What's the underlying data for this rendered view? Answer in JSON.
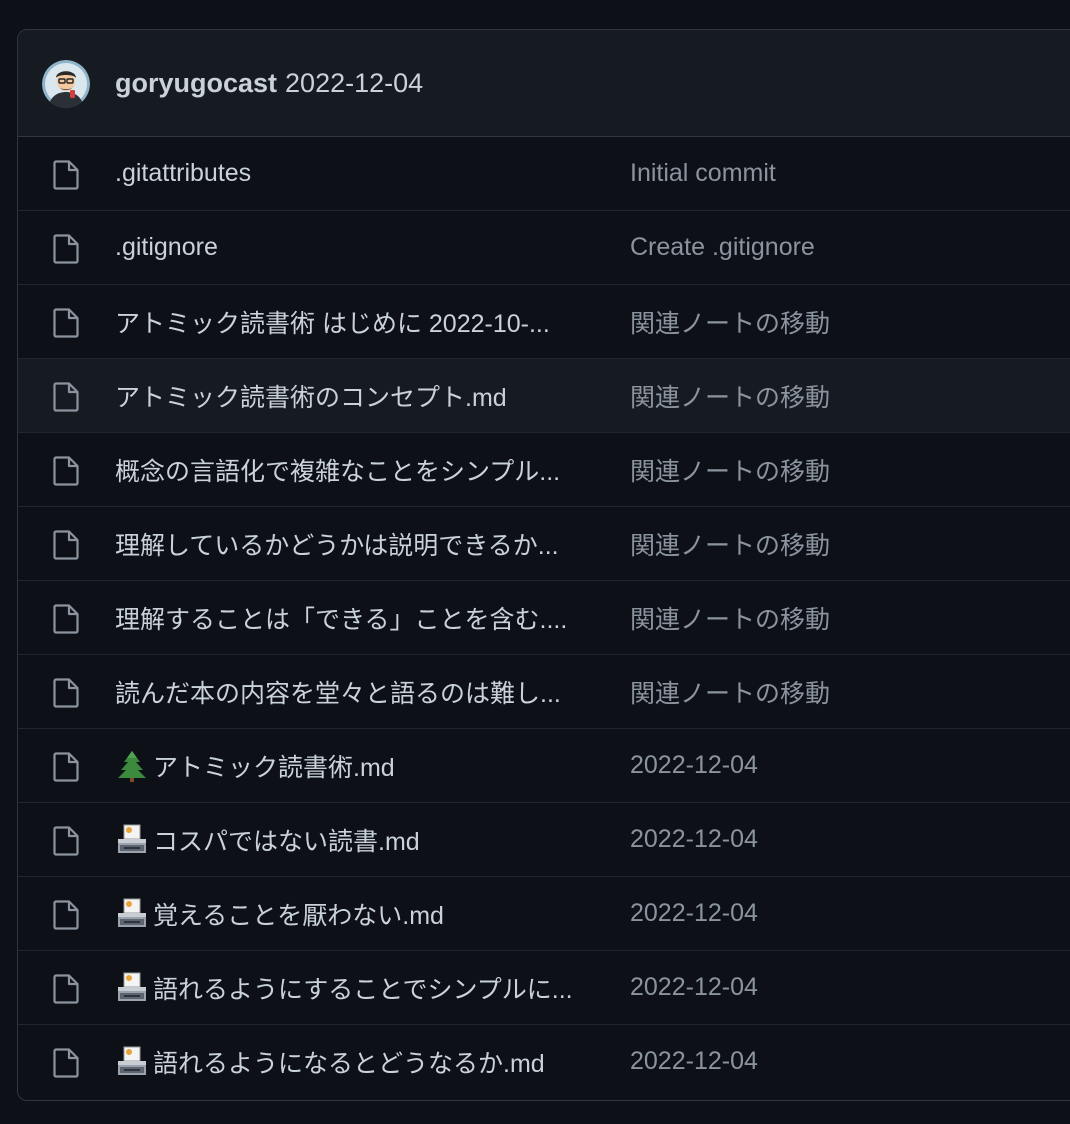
{
  "commit": {
    "author": "goryugocast",
    "message": "2022-12-04",
    "avatar_icon": "avatar-icon"
  },
  "colors": {
    "background": "#0d1117",
    "header_background": "#161b22",
    "border": "#30363d",
    "text": "#c9d1d9",
    "muted": "#8b949e"
  },
  "files": [
    {
      "name": ".gitattributes",
      "commit": "Initial commit",
      "icon": "file-icon",
      "emoji": ""
    },
    {
      "name": ".gitignore",
      "commit": "Create .gitignore",
      "icon": "file-icon",
      "emoji": ""
    },
    {
      "name": "アトミック読書術 はじめに 2022-10-...",
      "commit": "関連ノートの移動",
      "icon": "file-icon",
      "emoji": ""
    },
    {
      "name": "アトミック読書術のコンセプト.md",
      "commit": "関連ノートの移動",
      "icon": "file-icon",
      "emoji": ""
    },
    {
      "name": "概念の言語化で複雑なことをシンプル...",
      "commit": "関連ノートの移動",
      "icon": "file-icon",
      "emoji": ""
    },
    {
      "name": "理解しているかどうかは説明できるか...",
      "commit": "関連ノートの移動",
      "icon": "file-icon",
      "emoji": ""
    },
    {
      "name": "理解することは「できる」ことを含む....",
      "commit": "関連ノートの移動",
      "icon": "file-icon",
      "emoji": ""
    },
    {
      "name": "読んだ本の内容を堂々と語るのは難し...",
      "commit": "関連ノートの移動",
      "icon": "file-icon",
      "emoji": ""
    },
    {
      "name": "アトミック読書術.md",
      "commit": "2022-12-04",
      "icon": "file-icon",
      "emoji": "evergreen-tree-icon"
    },
    {
      "name": "コスパではない読書.md",
      "commit": "2022-12-04",
      "icon": "file-icon",
      "emoji": "inbox-tray-icon"
    },
    {
      "name": "覚えることを厭わない.md",
      "commit": "2022-12-04",
      "icon": "file-icon",
      "emoji": "inbox-tray-icon"
    },
    {
      "name": "語れるようにすることでシンプルに...",
      "commit": "2022-12-04",
      "icon": "file-icon",
      "emoji": "inbox-tray-icon"
    },
    {
      "name": "語れるようになるとどうなるか.md",
      "commit": "2022-12-04",
      "icon": "file-icon",
      "emoji": "inbox-tray-icon"
    }
  ]
}
